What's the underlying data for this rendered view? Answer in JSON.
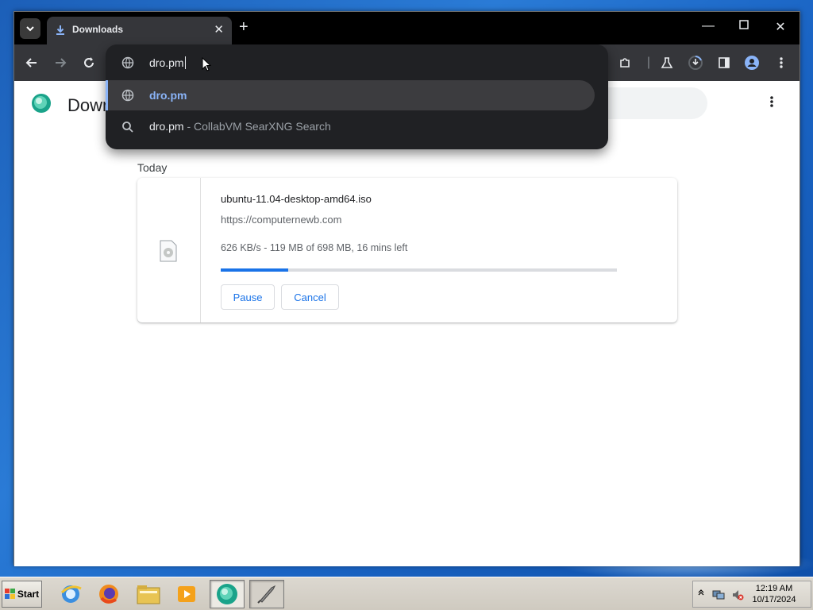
{
  "tab": {
    "title": "Downloads"
  },
  "omnibox": {
    "input_value": "dro.pm",
    "suggestions": [
      {
        "text": "dro.pm",
        "icon": "globe-icon",
        "selected": true
      },
      {
        "text": "dro.pm",
        "sub": " - CollabVM SearXNG Search",
        "icon": "search-icon"
      }
    ]
  },
  "page": {
    "heading": "Downloads",
    "date_group": "Today",
    "download": {
      "file_name": "ubuntu-11.04-desktop-amd64.iso",
      "url": "https://computernewb.com",
      "status": "626 KB/s - 119 MB of 698 MB, 16 mins left",
      "progress_fraction": 0.17,
      "pause_label": "Pause",
      "cancel_label": "Cancel"
    }
  },
  "taskbar": {
    "start_label": "Start",
    "clock_time": "12:19 AM",
    "clock_date": "10/17/2024"
  },
  "colors": {
    "accent": "#1a73e8",
    "omnibox_bg": "#202124",
    "selected_text": "#8ab4f8"
  }
}
